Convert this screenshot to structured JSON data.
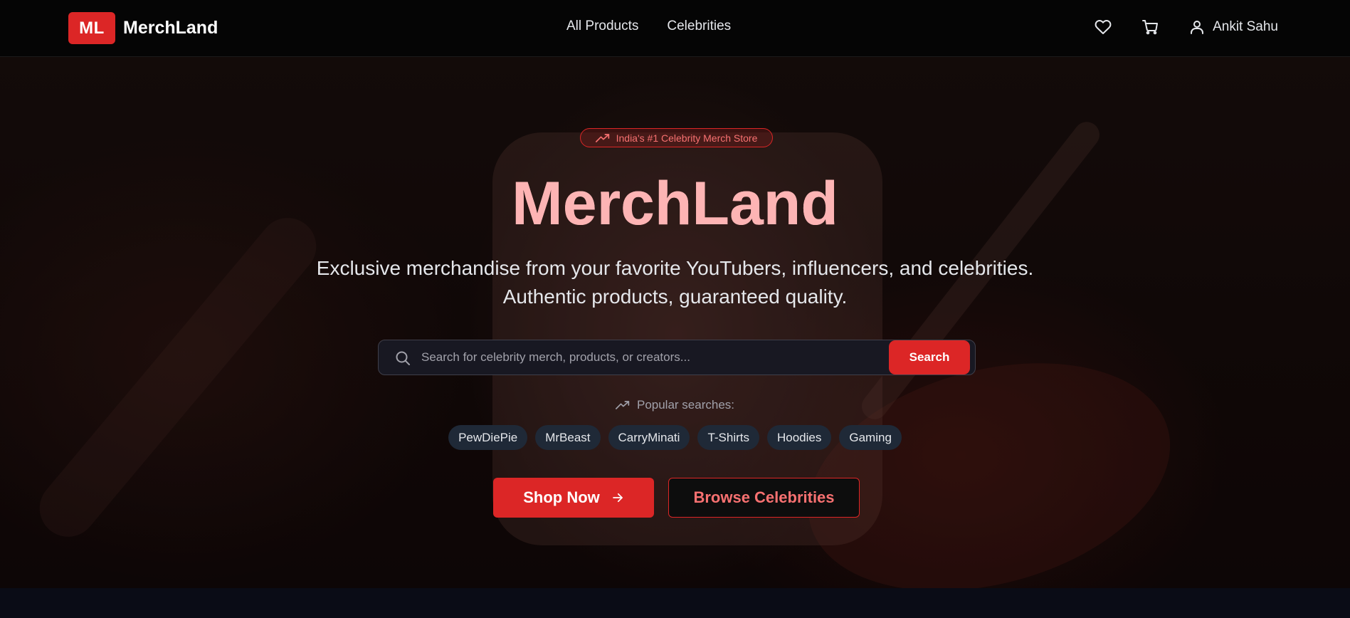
{
  "navbar": {
    "logo_badge": "ML",
    "logo_name": "MerchLand",
    "links": [
      {
        "label": "All Products"
      },
      {
        "label": "Celebrities"
      }
    ],
    "icons": [
      "heart-icon",
      "cart-icon",
      "user-icon"
    ],
    "user_name": "Ankit Sahu"
  },
  "hero": {
    "badge": "India's #1 Celebrity Merch Store",
    "title": "MerchLand",
    "subtitle_line1": "Exclusive merchandise from your favorite YouTubers, influencers, and celebrities.",
    "subtitle_line2": "Authentic products, guaranteed quality.",
    "search": {
      "placeholder": "Search for celebrity merch, products, or creators...",
      "value": "",
      "button_label": "Search"
    },
    "popular_label": "Popular searches:",
    "popular_tags": [
      "PewDiePie",
      "MrBeast",
      "CarryMinati",
      "T-Shirts",
      "Hoodies",
      "Gaming"
    ],
    "primary_cta": "Shop Now",
    "secondary_cta": "Browse Celebrities"
  },
  "colors": {
    "accent": "#dc2626",
    "accent_light": "#f87171",
    "title_gradient_start": "#fecaca",
    "title_gradient_end": "#fca5a5",
    "navbar_bg": "#050505",
    "tag_bg": "#1f2937"
  }
}
